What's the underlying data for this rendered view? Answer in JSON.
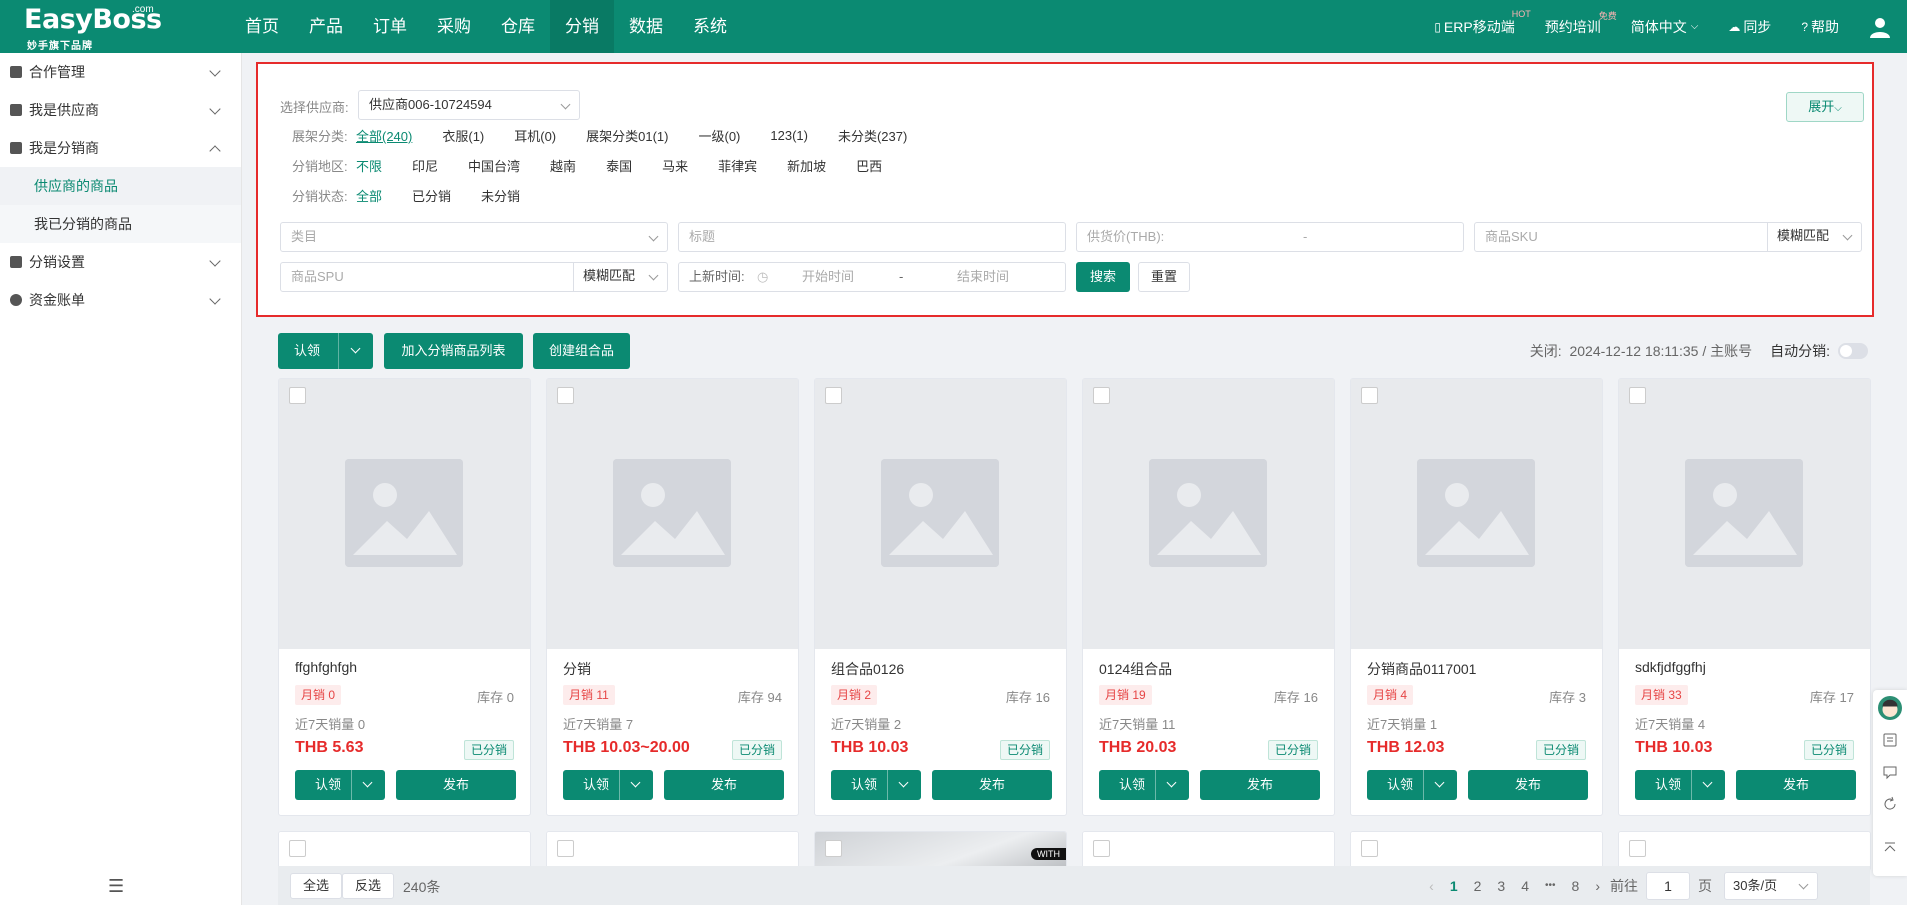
{
  "header": {
    "logo_brand": "EasyBoss",
    "logo_com": ".com",
    "logo_sub": "妙手旗下品牌",
    "nav": [
      "首页",
      "产品",
      "订单",
      "采购",
      "仓库",
      "分销",
      "数据",
      "系统"
    ],
    "active_nav": 5,
    "erp_mobile": "ERP移动端",
    "erp_badge": "HOT",
    "training": "预约培训",
    "training_badge": "免费",
    "language": "简体中文",
    "sync": "同步",
    "help": "帮助"
  },
  "sidebar": {
    "groups": [
      {
        "label": "合作管理",
        "icon": "cooperation-icon"
      },
      {
        "label": "我是供应商",
        "icon": "supplier-icon"
      },
      {
        "label": "我是分销商",
        "icon": "distributor-icon"
      }
    ],
    "subitems": [
      "供应商的商品",
      "我已分销的商品"
    ],
    "groups2": [
      {
        "label": "分销设置",
        "icon": "settings-icon"
      },
      {
        "label": "资金账单",
        "icon": "bill-icon"
      }
    ]
  },
  "filter": {
    "supplier_label": "选择供应商:",
    "supplier_value": "供应商006-10724594",
    "expand_label": "展开",
    "category_row": {
      "label": "展架分类:",
      "options": [
        "全部(240)",
        "衣服(1)",
        "耳机(0)",
        "展架分类01(1)",
        "一级(0)",
        "123(1)",
        "未分类(237)"
      ]
    },
    "region_row": {
      "label": "分销地区:",
      "options": [
        "不限",
        "印尼",
        "中国台湾",
        "越南",
        "泰国",
        "马来",
        "菲律宾",
        "新加坡",
        "巴西"
      ]
    },
    "status_row": {
      "label": "分销状态:",
      "options": [
        "全部",
        "已分销",
        "未分销"
      ]
    },
    "category_placeholder": "类目",
    "title_placeholder": "标题",
    "price_label": "供货价(THB):",
    "price_sep": "-",
    "sku_placeholder": "商品SKU",
    "sku_match": "模糊匹配",
    "spu_placeholder": "商品SPU",
    "spu_match": "模糊匹配",
    "time_label": "上新时间:",
    "start_time": "开始时间",
    "time_sep": "-",
    "end_time": "结束时间",
    "search_label": "搜索",
    "reset_label": "重置"
  },
  "toolbar": {
    "claim_label": "认领",
    "add_list_label": "加入分销商品列表",
    "create_combo_label": "创建组合品",
    "close_info": "关闭:  2024-12-12 18:11:35 / 主账号",
    "auto_dist_label": "自动分销:"
  },
  "products": [
    {
      "name": "ffghfghfgh",
      "sold": "月销 0",
      "stock": "库存 0",
      "seven": "近7天销量 0",
      "price": "THB 5.63",
      "status": "已分销"
    },
    {
      "name": "分销",
      "sold": "月销 11",
      "stock": "库存 94",
      "seven": "近7天销量 7",
      "price": "THB 10.03~20.00",
      "status": "已分销"
    },
    {
      "name": "组合品0126",
      "sold": "月销 2",
      "stock": "库存 16",
      "seven": "近7天销量 2",
      "price": "THB 10.03",
      "status": "已分销"
    },
    {
      "name": "0124组合品",
      "sold": "月销 19",
      "stock": "库存 16",
      "seven": "近7天销量 11",
      "price": "THB 20.03",
      "status": "已分销"
    },
    {
      "name": "分销商品0117001",
      "sold": "月销 4",
      "stock": "库存 3",
      "seven": "近7天销量 1",
      "price": "THB 12.03",
      "status": "已分销"
    },
    {
      "name": "sdkfjdfggfhj",
      "sold": "月销 33",
      "stock": "库存 17",
      "seven": "近7天销量 4",
      "price": "THB 10.03",
      "status": "已分销"
    }
  ],
  "card_buttons": {
    "claim": "认领",
    "publish": "发布"
  },
  "row2_watermark": "WITH",
  "bottom": {
    "select_all": "全选",
    "invert": "反选",
    "total": "240条",
    "pages": [
      "1",
      "2",
      "3",
      "4",
      "•••",
      "8"
    ],
    "goto_label": "前往",
    "goto_value": "1",
    "page_unit": "页",
    "page_size": "30条/页"
  }
}
